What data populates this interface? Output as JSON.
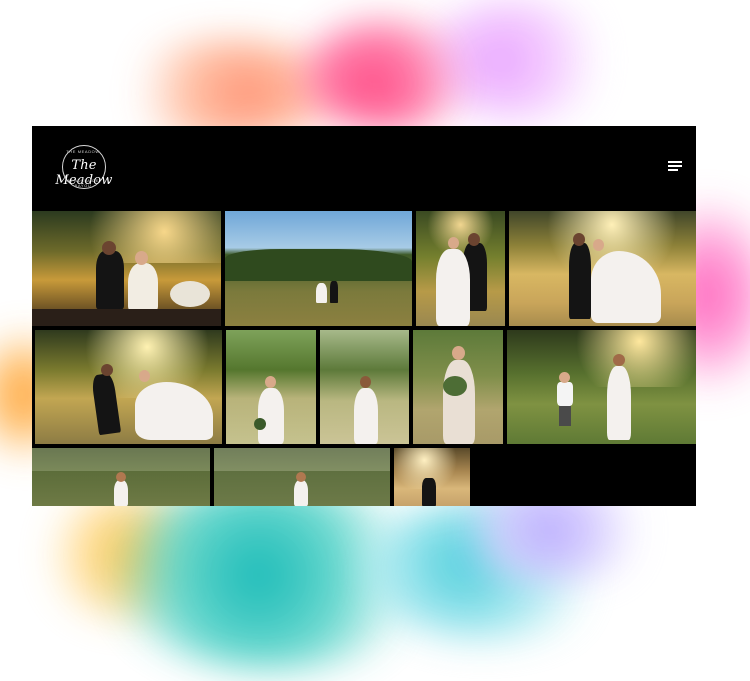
{
  "site": {
    "logo": {
      "script_text": "The Meadow",
      "ring_top_text": "THE MEADOW",
      "ring_bottom_text": "AT ADELAIDE BAYOU"
    },
    "menu_icon": "hamburger-menu-icon"
  },
  "gallery": {
    "row_count": 3,
    "photos_per_row": [
      4,
      5,
      3
    ],
    "photos": [
      {
        "id": "p1",
        "subject": "couple-table-sunset"
      },
      {
        "id": "p2",
        "subject": "couple-field-wide"
      },
      {
        "id": "p3",
        "subject": "couple-trees-portrait"
      },
      {
        "id": "p4",
        "subject": "couple-meadow-golden"
      },
      {
        "id": "p5",
        "subject": "couple-dancing-field"
      },
      {
        "id": "p6",
        "subject": "bride-field-bouquet"
      },
      {
        "id": "p7",
        "subject": "bride-back-field"
      },
      {
        "id": "p8",
        "subject": "bride-bouquet-portrait"
      },
      {
        "id": "p9",
        "subject": "bride-child-field"
      },
      {
        "id": "p10",
        "subject": "bride-trees-1"
      },
      {
        "id": "p11",
        "subject": "bride-trees-2"
      },
      {
        "id": "p12",
        "subject": "couple-sun-flare"
      }
    ]
  },
  "colors": {
    "site_background": "#000000",
    "ink_pink": "#ff3a78",
    "ink_teal": "#00b3b0",
    "ink_orange": "#ff9a28"
  }
}
